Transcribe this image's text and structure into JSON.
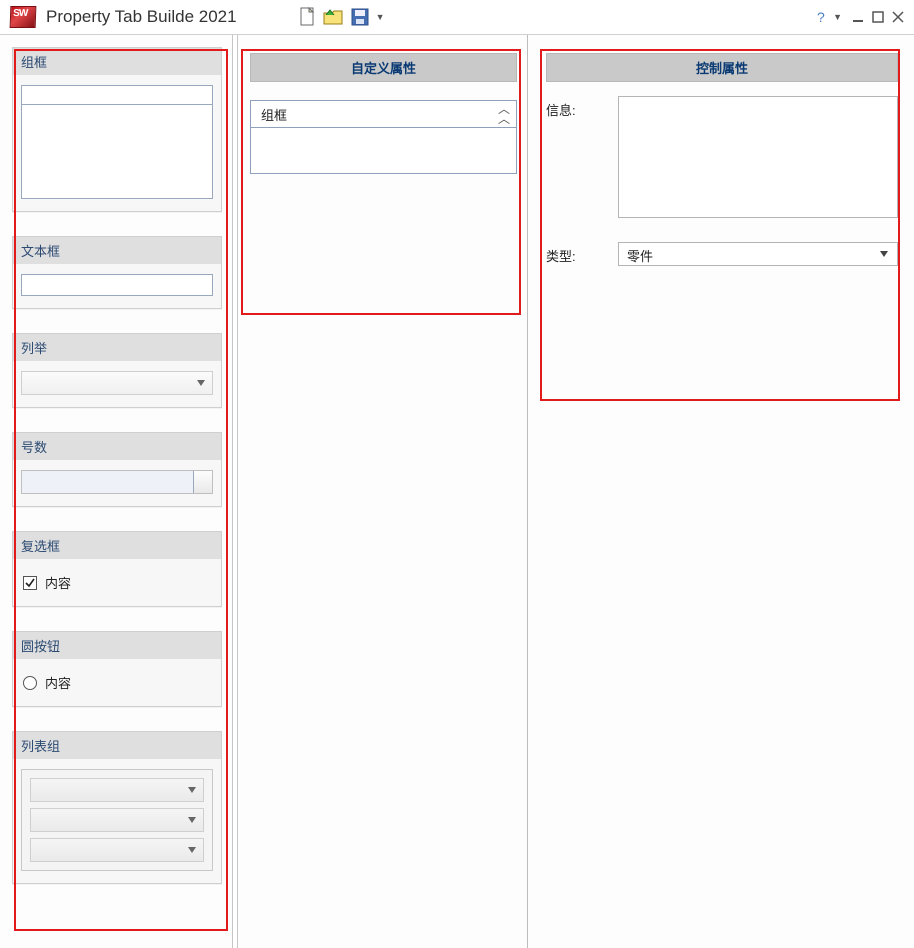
{
  "titlebar": {
    "app_title": "Property Tab Builde  2021"
  },
  "palette": {
    "groupbox": {
      "label": "组框"
    },
    "textbox": {
      "label": "文本框"
    },
    "list": {
      "label": "列举"
    },
    "number": {
      "label": "号数"
    },
    "checkbox": {
      "label": "复选框",
      "item": "内容"
    },
    "radio": {
      "label": "圆按钮",
      "item": "内容"
    },
    "listgroup": {
      "label": "列表组"
    }
  },
  "center": {
    "panel_title": "自定义属性",
    "groupbox_label": "组框"
  },
  "right": {
    "panel_title": "控制属性",
    "info_label": "信息:",
    "type_label": "类型:",
    "type_value": "零件"
  }
}
